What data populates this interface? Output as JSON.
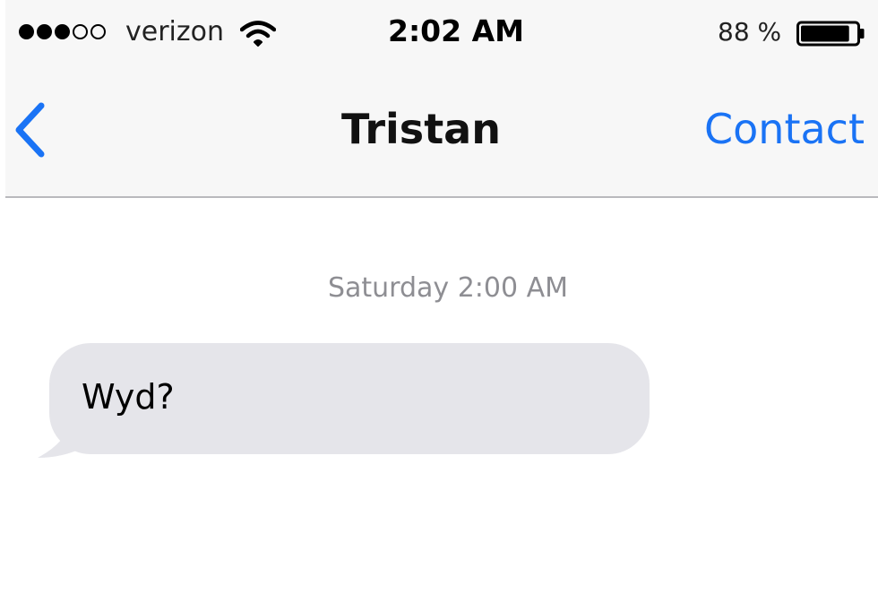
{
  "status_bar": {
    "signal_bars_filled": 3,
    "signal_bars_total": 5,
    "carrier": "verizon",
    "wifi_icon": "wifi-icon",
    "time": "2:02 AM",
    "battery_percent": "88 %",
    "battery_level": 0.88
  },
  "nav": {
    "back_icon": "chevron-left-icon",
    "title": "Tristan",
    "contact_label": "Contact"
  },
  "conversation": {
    "timestamp": "Saturday 2:00 AM",
    "messages": [
      {
        "direction": "incoming",
        "text": "Wyd?"
      }
    ]
  },
  "colors": {
    "accent": "#1a73f5",
    "bubble_incoming": "#e5e5ea",
    "timestamp_gray": "#8e8e93",
    "nav_background": "#f7f7f7"
  }
}
